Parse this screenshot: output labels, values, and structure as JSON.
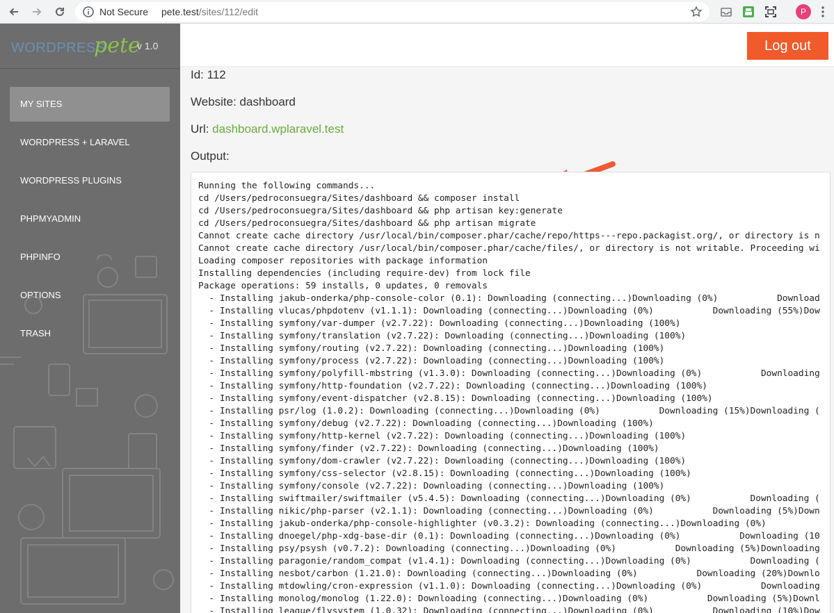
{
  "browser": {
    "security_label": "Not Secure",
    "url_host": "pete.test",
    "url_path": "/sites/112/edit",
    "profile_initial": "P"
  },
  "brand": {
    "wordpress": "WORDPRESS",
    "pete": "pete",
    "version": "v 1.0"
  },
  "sidebar": {
    "items": [
      {
        "label": "MY SITES"
      },
      {
        "label": "WORDPRESS + LARAVEL"
      },
      {
        "label": "WORDPRESS PLUGINS"
      },
      {
        "label": "PHPMYADMIN"
      },
      {
        "label": "PHPINFO"
      },
      {
        "label": "OPTIONS"
      },
      {
        "label": "TRASH"
      }
    ]
  },
  "header": {
    "logout_label": "Log out"
  },
  "site": {
    "id_line": "Id: 112",
    "website_line": "Website: dashboard",
    "url_prefix": "Url: ",
    "url_link": "dashboard.wplaravel.test",
    "output_label": "Output:"
  },
  "output_lines": [
    "Running the following commands...",
    "cd /Users/pedroconsuegra/Sites/dashboard && composer install",
    "cd /Users/pedroconsuegra/Sites/dashboard && php artisan key:generate",
    "cd /Users/pedroconsuegra/Sites/dashboard && php artisan migrate",
    "Cannot create cache directory /usr/local/bin/composer.phar/cache/repo/https---repo.packagist.org/, or directory is n",
    "Cannot create cache directory /usr/local/bin/composer.phar/cache/files/, or directory is not writable. Proceeding wi",
    "Loading composer repositories with package information",
    "Installing dependencies (including require-dev) from lock file",
    "Package operations: 59 installs, 0 updates, 0 removals",
    "  - Installing jakub-onderka/php-console-color (0.1): Downloading (connecting...)Downloading (0%)           Download",
    "  - Installing vlucas/phpdotenv (v1.1.1): Downloading (connecting...)Downloading (0%)           Downloading (55%)Dow",
    "  - Installing symfony/var-dumper (v2.7.22): Downloading (connecting...)Downloading (100%)",
    "  - Installing symfony/translation (v2.7.22): Downloading (connecting...)Downloading (100%)",
    "  - Installing symfony/routing (v2.7.22): Downloading (connecting...)Downloading (100%)",
    "  - Installing symfony/process (v2.7.22): Downloading (connecting...)Downloading (100%)",
    "  - Installing symfony/polyfill-mbstring (v1.3.0): Downloading (connecting...)Downloading (0%)           Downloading",
    "  - Installing symfony/http-foundation (v2.7.22): Downloading (connecting...)Downloading (100%)",
    "  - Installing symfony/event-dispatcher (v2.8.15): Downloading (connecting...)Downloading (100%)",
    "  - Installing psr/log (1.0.2): Downloading (connecting...)Downloading (0%)           Downloading (15%)Downloading (",
    "  - Installing symfony/debug (v2.7.22): Downloading (connecting...)Downloading (100%)",
    "  - Installing symfony/http-kernel (v2.7.22): Downloading (connecting...)Downloading (100%)",
    "  - Installing symfony/finder (v2.7.22): Downloading (connecting...)Downloading (100%)",
    "  - Installing symfony/dom-crawler (v2.7.22): Downloading (connecting...)Downloading (100%)",
    "  - Installing symfony/css-selector (v2.8.15): Downloading (connecting...)Downloading (100%)",
    "  - Installing symfony/console (v2.7.22): Downloading (connecting...)Downloading (100%)",
    "  - Installing swiftmailer/swiftmailer (v5.4.5): Downloading (connecting...)Downloading (0%)           Downloading (",
    "  - Installing nikic/php-parser (v2.1.1): Downloading (connecting...)Downloading (0%)           Downloading (5%)Down",
    "  - Installing jakub-onderka/php-console-highlighter (v0.3.2): Downloading (connecting...)Downloading (0%)",
    "  - Installing dnoegel/php-xdg-base-dir (0.1): Downloading (connecting...)Downloading (0%)           Downloading (10",
    "  - Installing psy/psysh (v0.7.2): Downloading (connecting...)Downloading (0%)           Downloading (5%)Downloading",
    "  - Installing paragonie/random_compat (v1.4.1): Downloading (connecting...)Downloading (0%)           Downloading (",
    "  - Installing nesbot/carbon (1.21.0): Downloading (connecting...)Downloading (0%)           Downloading (20%)Downlo",
    "  - Installing mtdowling/cron-expression (v1.1.0): Downloading (connecting...)Downloading (0%)           Downloading",
    "  - Installing monolog/monolog (1.22.0): Downloading (connecting...)Downloading (0%)           Downloading (5%)Downl",
    "  - Installing league/flysystem (1.0.32): Downloading (connecting...)Downloading (0%)           Downloading (10%)Dow"
  ]
}
